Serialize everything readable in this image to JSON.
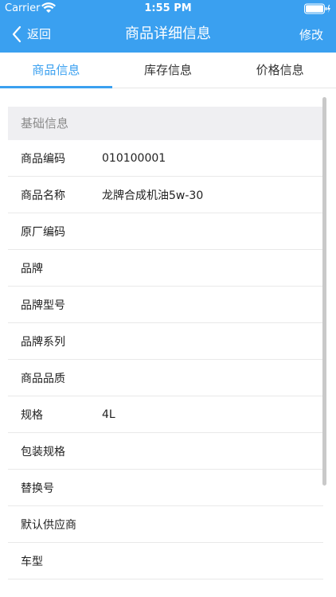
{
  "status_bar": {
    "carrier": "Carrier",
    "time": "1:55 PM"
  },
  "nav": {
    "back_label": "返回",
    "title": "商品详细信息",
    "edit_label": "修改"
  },
  "tabs": [
    {
      "label": "商品信息",
      "active": true
    },
    {
      "label": "库存信息",
      "active": false
    },
    {
      "label": "价格信息",
      "active": false
    }
  ],
  "section": {
    "title": "基础信息"
  },
  "rows": [
    {
      "label": "商品编码",
      "value": "010100001"
    },
    {
      "label": "商品名称",
      "value": "龙牌合成机油5w-30"
    },
    {
      "label": "原厂编码",
      "value": ""
    },
    {
      "label": "品牌",
      "value": ""
    },
    {
      "label": "品牌型号",
      "value": ""
    },
    {
      "label": "品牌系列",
      "value": ""
    },
    {
      "label": "商品品质",
      "value": ""
    },
    {
      "label": "规格",
      "value": "4L"
    },
    {
      "label": "包装规格",
      "value": ""
    },
    {
      "label": "替换号",
      "value": ""
    },
    {
      "label": "默认供应商",
      "value": ""
    },
    {
      "label": "车型",
      "value": ""
    }
  ],
  "colors": {
    "primary": "#3aa0f0",
    "section_bg": "#efeff2",
    "divider": "#e9e9e9"
  }
}
